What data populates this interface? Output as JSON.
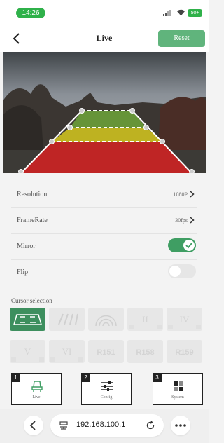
{
  "status": {
    "time": "14:26",
    "battery": "50+"
  },
  "nav": {
    "title": "Live",
    "reset_label": "Reset"
  },
  "settings": {
    "resolution": {
      "label": "Resolution",
      "value": "1080P"
    },
    "framerate": {
      "label": "FrameRate",
      "value": "30fps"
    },
    "mirror": {
      "label": "Mirror",
      "enabled": true
    },
    "flip": {
      "label": "Flip",
      "enabled": false
    }
  },
  "cursor": {
    "label": "Cursor selection",
    "tiles": [
      "",
      "",
      "",
      "II",
      "IV",
      "V",
      "VI",
      "R151",
      "R158",
      "R159"
    ],
    "selected_index": 0
  },
  "tabs": [
    {
      "number": "1",
      "label": "Live",
      "icon": "car-seat-icon"
    },
    {
      "number": "2",
      "label": "Config",
      "icon": "sliders-icon"
    },
    {
      "number": "3",
      "label": "System",
      "icon": "grid-icon"
    }
  ],
  "browser": {
    "url": "192.168.100.1"
  },
  "colors": {
    "accent": "#3f9e63",
    "reset": "#60b47c",
    "time_pill": "#2fb14a"
  }
}
